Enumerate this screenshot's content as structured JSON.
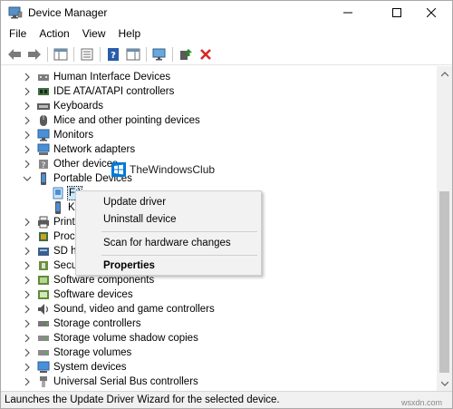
{
  "window": {
    "title": "Device Manager"
  },
  "menu": [
    "File",
    "Action",
    "View",
    "Help"
  ],
  "tree": [
    {
      "label": "Human Interface Devices",
      "icon": "hid-icon"
    },
    {
      "label": "IDE ATA/ATAPI controllers",
      "icon": "ide-controller-icon"
    },
    {
      "label": "Keyboards",
      "icon": "keyboard-icon"
    },
    {
      "label": "Mice and other pointing devices",
      "icon": "mouse-icon"
    },
    {
      "label": "Monitors",
      "icon": "monitor-icon"
    },
    {
      "label": "Network adapters",
      "icon": "network-adapter-icon"
    },
    {
      "label": "Other devices",
      "icon": "other-devices-icon"
    },
    {
      "label": "Portable Devices",
      "icon": "portable-device-icon",
      "expanded": true
    },
    {
      "label": "F:\\",
      "icon": "portable-drive-icon",
      "child": true,
      "selected": true
    },
    {
      "label": "K",
      "icon": "portable-drive-icon",
      "child": true
    },
    {
      "label": "Print",
      "icon": "printer-icon"
    },
    {
      "label": "Proce",
      "icon": "processor-icon"
    },
    {
      "label": "SD ho",
      "icon": "sd-host-icon"
    },
    {
      "label": "Secur",
      "icon": "security-device-icon"
    },
    {
      "label": "Software components",
      "icon": "software-component-icon"
    },
    {
      "label": "Software devices",
      "icon": "software-device-icon"
    },
    {
      "label": "Sound, video and game controllers",
      "icon": "sound-icon"
    },
    {
      "label": "Storage controllers",
      "icon": "storage-controller-icon"
    },
    {
      "label": "Storage volume shadow copies",
      "icon": "storage-shadow-icon"
    },
    {
      "label": "Storage volumes",
      "icon": "storage-volume-icon"
    },
    {
      "label": "System devices",
      "icon": "system-device-icon"
    },
    {
      "label": "Universal Serial Bus controllers",
      "icon": "usb-icon"
    }
  ],
  "context_menu": {
    "update": "Update driver",
    "uninstall": "Uninstall device",
    "scan": "Scan for hardware changes",
    "properties": "Properties"
  },
  "watermark": "TheWindowsClub",
  "status": "Launches the Update Driver Wizard for the selected device.",
  "bottom_mark": "wsxdn.com",
  "colors": {
    "accent": "#0078d7",
    "close_red": "#d9262b",
    "green_arrow": "#2b8a2b"
  }
}
